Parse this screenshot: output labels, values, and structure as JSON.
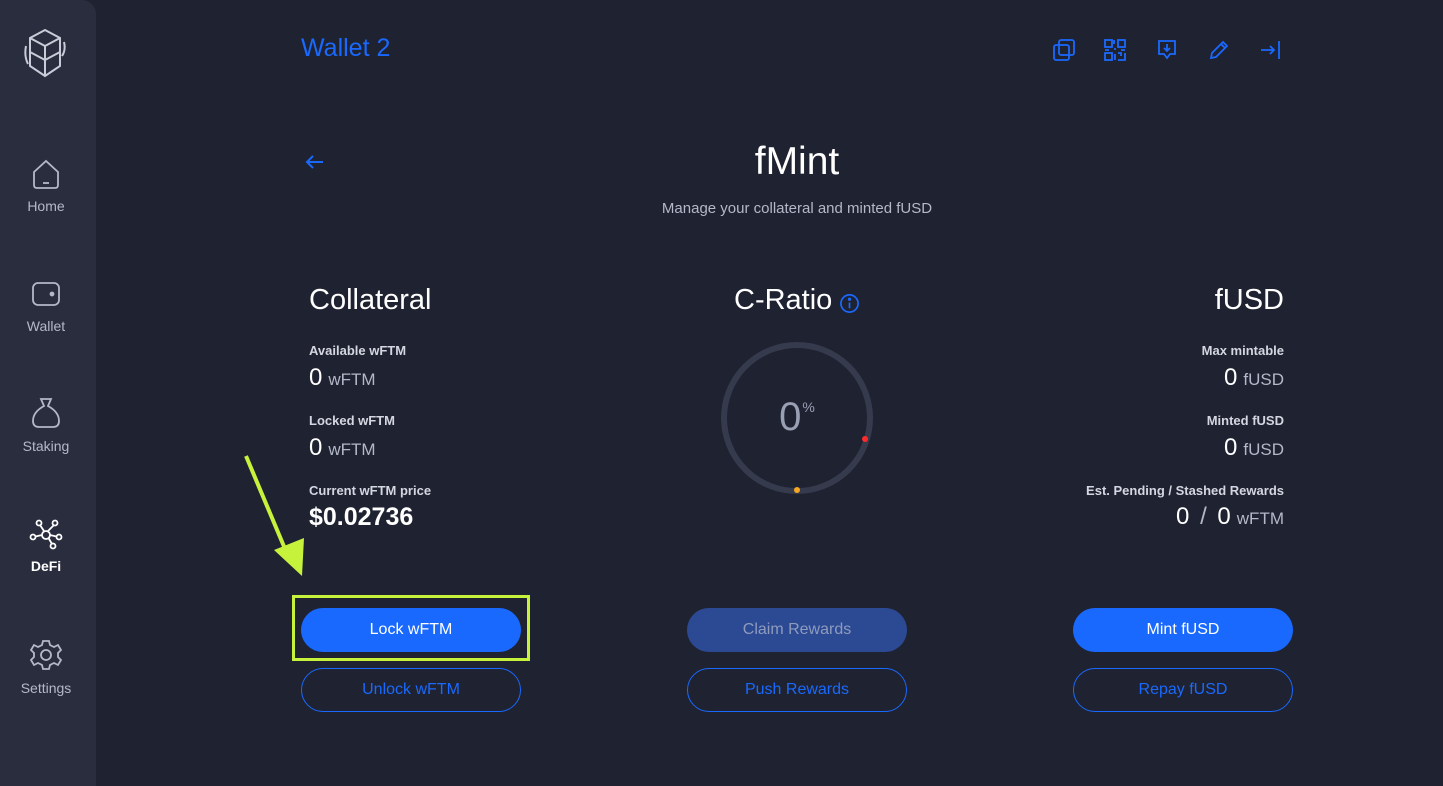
{
  "sidebar": {
    "items": [
      {
        "label": "Home",
        "icon": "home-icon",
        "active": false
      },
      {
        "label": "Wallet",
        "icon": "wallet-icon",
        "active": false
      },
      {
        "label": "Staking",
        "icon": "bag-icon",
        "active": false
      },
      {
        "label": "DeFi",
        "icon": "defi-icon",
        "active": true
      },
      {
        "label": "Settings",
        "icon": "gear-icon",
        "active": false
      }
    ]
  },
  "header": {
    "wallet_title": "Wallet 2",
    "actions": [
      "copy-icon",
      "qr-code-icon",
      "receive-icon",
      "edit-icon",
      "logout-icon"
    ]
  },
  "page": {
    "title": "fMint",
    "subtitle": "Manage your collateral and minted fUSD"
  },
  "collateral": {
    "heading": "Collateral",
    "available_label": "Available wFTM",
    "available_value": "0",
    "available_unit": "wFTM",
    "locked_label": "Locked wFTM",
    "locked_value": "0",
    "locked_unit": "wFTM",
    "price_label": "Current wFTM price",
    "price_value": "$0.02736",
    "lock_button": "Lock wFTM",
    "unlock_button": "Unlock wFTM"
  },
  "cratio": {
    "heading": "C-Ratio",
    "value": "0",
    "value_suffix": "%",
    "claim_button": "Claim Rewards",
    "push_button": "Push Rewards"
  },
  "fusd": {
    "heading": "fUSD",
    "max_label": "Max mintable",
    "max_value": "0",
    "max_unit": "fUSD",
    "minted_label": "Minted fUSD",
    "minted_value": "0",
    "minted_unit": "fUSD",
    "rewards_label": "Est. Pending / Stashed Rewards",
    "pending_value": "0",
    "separator": "/",
    "stashed_value": "0",
    "rewards_unit": "wFTM",
    "mint_button": "Mint fUSD",
    "repay_button": "Repay fUSD"
  },
  "colors": {
    "accent": "#1969ff",
    "background": "#1f2230",
    "sidebar": "#2a2d3d",
    "highlight": "#c7f23c",
    "gauge_red": "#ff2a2a",
    "gauge_orange": "#f5a623"
  }
}
